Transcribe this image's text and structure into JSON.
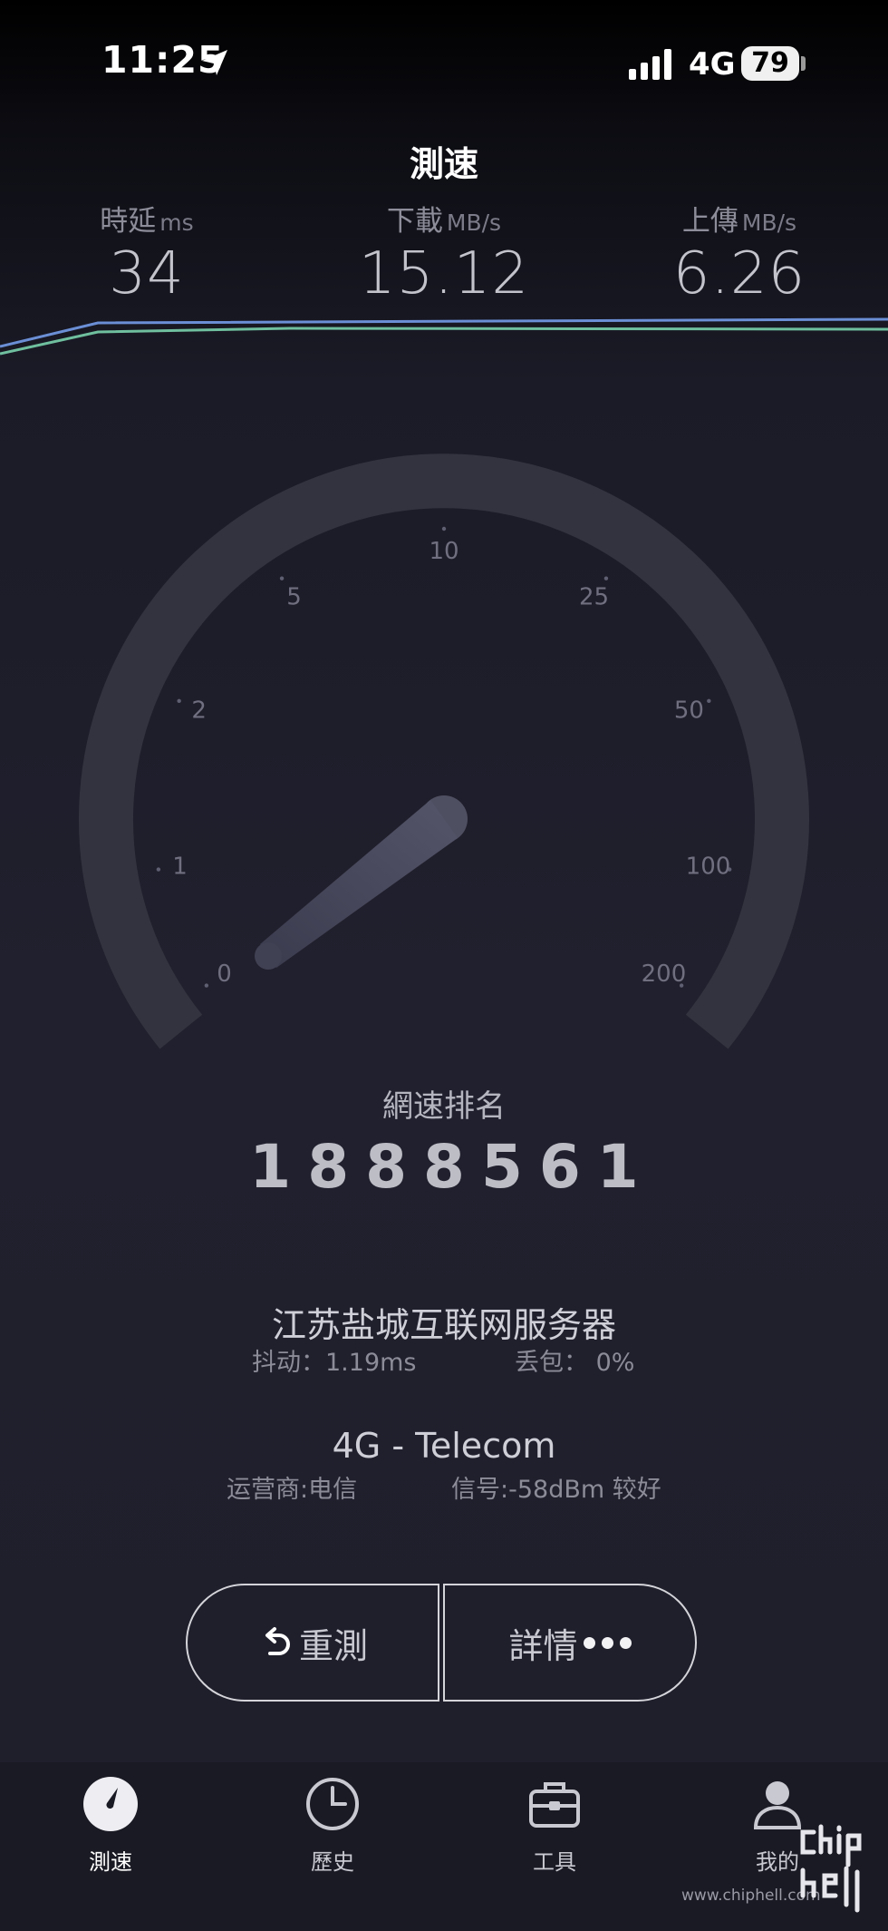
{
  "status_bar": {
    "time": "11:25",
    "network": "4G",
    "battery": "79"
  },
  "header": {
    "title": "測速"
  },
  "metrics": {
    "latency": {
      "label": "時延",
      "unit": "ms",
      "value": "34"
    },
    "download": {
      "label": "下載",
      "unit": "MB/s",
      "value": "15.12"
    },
    "upload": {
      "label": "上傳",
      "unit": "MB/s",
      "value": "6.26"
    }
  },
  "trend": {
    "download_color": "#6b8fd6",
    "upload_color": "#6fbf9e"
  },
  "gauge": {
    "ticks": [
      "0",
      "1",
      "2",
      "5",
      "10",
      "25",
      "50",
      "100",
      "200"
    ],
    "needle_value": "0.5"
  },
  "rank": {
    "label": "網速排名",
    "value": "1888561"
  },
  "server": {
    "name": "江苏盐城互联网服务器",
    "jitter": "抖动：1.19ms",
    "packet_loss": "丢包： 0%"
  },
  "network": {
    "type": "4G - Telecom",
    "carrier": "运营商:电信",
    "signal": "信号:-58dBm 较好"
  },
  "actions": {
    "retest": "重測",
    "details": "詳情"
  },
  "tab_bar": {
    "items": [
      {
        "label": "測速",
        "icon": "speedometer-icon",
        "active": true
      },
      {
        "label": "歷史",
        "icon": "clock-icon",
        "active": false
      },
      {
        "label": "工具",
        "icon": "toolbox-icon",
        "active": false
      },
      {
        "label": "我的",
        "icon": "user-icon",
        "active": false
      }
    ]
  },
  "watermark": {
    "text": "www.chiphell.com",
    "logo": "chip hell"
  }
}
